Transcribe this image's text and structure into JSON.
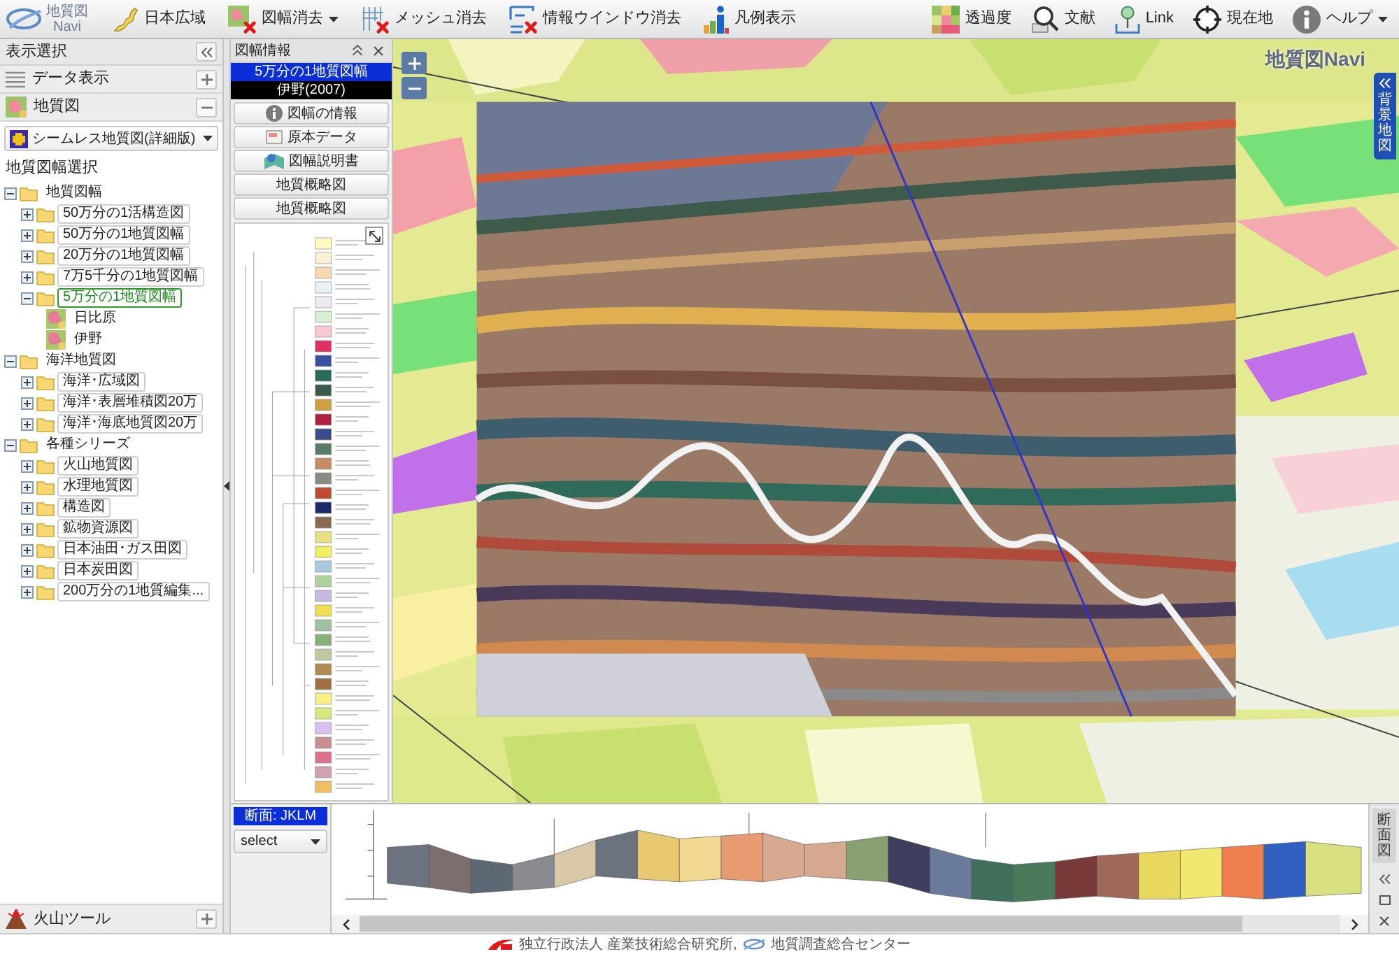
{
  "toolbar": {
    "logo": {
      "title": "地質図",
      "subtitle": "Navi"
    },
    "left_items": [
      {
        "label": "日本広域",
        "menu": false
      },
      {
        "label": "図幅消去",
        "menu": true
      },
      {
        "label": "メッシュ消去",
        "menu": false
      },
      {
        "label": "情報ウインドウ消去",
        "menu": false
      },
      {
        "label": "凡例表示",
        "menu": false
      }
    ],
    "right_items": [
      {
        "label": "透過度",
        "menu": false
      },
      {
        "label": "文献",
        "menu": false
      },
      {
        "label": "Link",
        "menu": false
      },
      {
        "label": "現在地",
        "menu": false
      },
      {
        "label": "ヘルプ",
        "menu": true
      }
    ]
  },
  "sidebar": {
    "title": "表示選択",
    "sections": [
      {
        "label": "データ表示",
        "expanded": false
      },
      {
        "label": "地質図",
        "expanded": true
      }
    ],
    "layer_select": {
      "value": "シームレス地質図(詳細版)"
    },
    "tree_title": "地質図幅選択",
    "tree": [
      {
        "label": "地質図幅",
        "kind": "folder",
        "expanded": true,
        "selected": false,
        "children": [
          {
            "label": "50万分の1活構造図",
            "kind": "folder",
            "expanded": false,
            "selected": false
          },
          {
            "label": "50万分の1地質図幅",
            "kind": "folder",
            "expanded": false,
            "selected": false
          },
          {
            "label": "20万分の1地質図幅",
            "kind": "folder",
            "expanded": false,
            "selected": false
          },
          {
            "label": "7万5千分の1地質図幅",
            "kind": "folder",
            "expanded": false,
            "selected": false
          },
          {
            "label": "5万分の1地質図幅",
            "kind": "folder",
            "expanded": true,
            "selected": true,
            "children": [
              {
                "label": "日比原",
                "kind": "sheet",
                "selected": false
              },
              {
                "label": "伊野",
                "kind": "sheet",
                "selected": false
              }
            ]
          }
        ]
      },
      {
        "label": "海洋地質図",
        "kind": "folder",
        "expanded": true,
        "selected": false,
        "children": [
          {
            "label": "海洋･広域図",
            "kind": "folder",
            "expanded": false,
            "selected": false
          },
          {
            "label": "海洋･表層堆積図20万",
            "kind": "folder",
            "expanded": false,
            "selected": false
          },
          {
            "label": "海洋･海底地質図20万",
            "kind": "folder",
            "expanded": false,
            "selected": false
          }
        ]
      },
      {
        "label": "各種シリーズ",
        "kind": "folder",
        "expanded": true,
        "selected": false,
        "children": [
          {
            "label": "火山地質図",
            "kind": "folder",
            "expanded": false,
            "selected": false
          },
          {
            "label": "水理地質図",
            "kind": "folder",
            "expanded": false,
            "selected": false
          },
          {
            "label": "構造図",
            "kind": "folder",
            "expanded": false,
            "selected": false
          },
          {
            "label": "鉱物資源図",
            "kind": "folder",
            "expanded": false,
            "selected": false
          },
          {
            "label": "日本油田･ガス田図",
            "kind": "folder",
            "expanded": false,
            "selected": false
          },
          {
            "label": "日本炭田図",
            "kind": "folder",
            "expanded": false,
            "selected": false
          },
          {
            "label": "200万分の1地質編集...",
            "kind": "folder",
            "expanded": false,
            "selected": false
          }
        ]
      }
    ],
    "bottom_section": {
      "label": "火山ツール",
      "expanded": false
    }
  },
  "info_panel": {
    "title": "図幅情報",
    "series": "5万分の1地質図幅",
    "sheet": "伊野(2007)",
    "buttons": [
      {
        "label": "図幅の情報"
      },
      {
        "label": "原本データ"
      },
      {
        "label": "図幅説明書"
      },
      {
        "label": "地質概略図"
      },
      {
        "label": "地質概略図"
      }
    ],
    "section_label": "断面: JKLM",
    "section_select": {
      "value": "select"
    }
  },
  "map": {
    "logo": "地質図Navi",
    "background_tab": {
      "label": "背景地図"
    }
  },
  "cross_section": {
    "tab_label": "断面図"
  },
  "footer": {
    "organization": "独立行政法人 産業技術総合研究所,",
    "center": "地質調査総合センター"
  }
}
